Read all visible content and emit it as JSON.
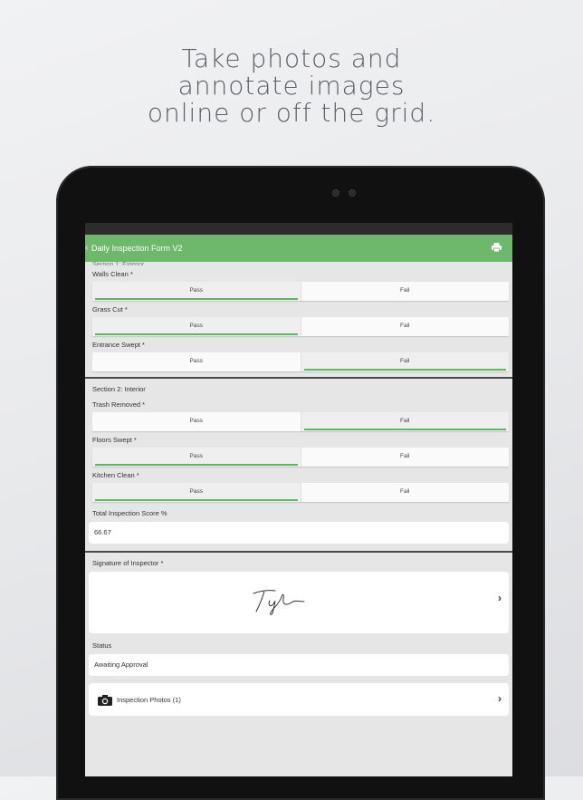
{
  "headline": {
    "line1": "Take photos and",
    "line2": "annotate images",
    "line3": "online or off the grid."
  },
  "colors": {
    "accent": "#6db86b",
    "selected_bar": "#5cb85c"
  },
  "app": {
    "back_glyph": "‹",
    "title": "Daily Inspection Form V2",
    "header_icon": "printer-icon",
    "peek_text": "Section 1: Exterior"
  },
  "section1": {
    "items": [
      {
        "label": "Walls Clean *",
        "pass": "Pass",
        "fail": "Fail",
        "selected": "pass"
      },
      {
        "label": "Grass Cut *",
        "pass": "Pass",
        "fail": "Fail",
        "selected": "pass"
      },
      {
        "label": "Entrance Swept *",
        "pass": "Pass",
        "fail": "Fail",
        "selected": "fail"
      }
    ]
  },
  "section2": {
    "title": "Section 2: Interior",
    "items": [
      {
        "label": "Trash Removed *",
        "pass": "Pass",
        "fail": "Fail",
        "selected": "fail"
      },
      {
        "label": "Floors Swept *",
        "pass": "Pass",
        "fail": "Fail",
        "selected": "pass"
      },
      {
        "label": "Kitchen Clean *",
        "pass": "Pass",
        "fail": "Fail",
        "selected": "pass"
      }
    ],
    "score_label": "Total Inspection Score %",
    "score_value": "66.67"
  },
  "signature": {
    "label": "Signature of Inspector *",
    "chevron": "›"
  },
  "status": {
    "label": "Status",
    "value": "Awaiting Approval"
  },
  "photos": {
    "icon": "camera-icon",
    "label": "Inspection Photos (1)",
    "chevron": "›"
  }
}
